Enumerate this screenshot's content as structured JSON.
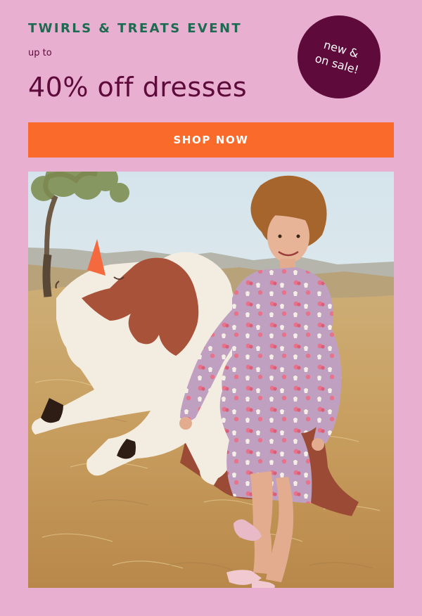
{
  "promo": {
    "eyebrow": "TWIRLS & TREATS EVENT",
    "qualifier": "up to",
    "headline": "40% off dresses",
    "cta_label": "SHOP NOW"
  },
  "badge": {
    "line1": "new &",
    "line2": "on sale!"
  },
  "colors": {
    "background": "#e8afd1",
    "eyebrow": "#1e6a50",
    "headline": "#5e0b3b",
    "badge": "#5e0b3b",
    "cta": "#fa6a2a"
  }
}
